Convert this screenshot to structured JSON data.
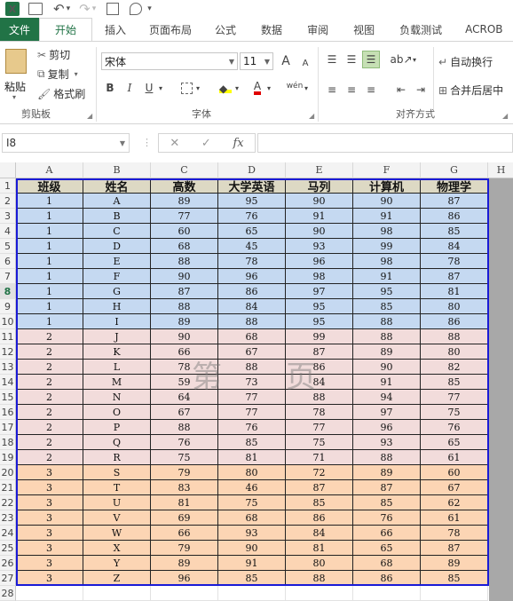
{
  "qat": {
    "save": "💾",
    "undo": "↶",
    "redo": "↷",
    "customize": "▾"
  },
  "tabs": [
    "文件",
    "开始",
    "插入",
    "页面布局",
    "公式",
    "数据",
    "审阅",
    "视图",
    "负载测试",
    "ACROB"
  ],
  "ribbon": {
    "clipboard": {
      "paste": "粘贴",
      "cut": "剪切",
      "copy": "复制",
      "format_painter": "格式刷",
      "label": "剪贴板"
    },
    "font": {
      "family": "宋体",
      "size": "11",
      "grow": "A",
      "shrink": "A",
      "bold": "B",
      "italic": "I",
      "underline": "U",
      "wen": "wén",
      "font_color": "A",
      "label": "字体"
    },
    "alignment": {
      "wrap": "自动换行",
      "merge": "合并后居中",
      "label": "对齐方式"
    }
  },
  "formula_bar": {
    "name_box": "I8",
    "fx": "fx",
    "value": ""
  },
  "colors": {
    "accent": "#217346",
    "group1": "#c5d9f1",
    "group2": "#f2dcdb",
    "group3": "#fcd5b4",
    "header_fill": "#ddd9c4",
    "border_blue": "#1a1ad6"
  },
  "sheet": {
    "columns": [
      "A",
      "B",
      "C",
      "D",
      "E",
      "F",
      "G",
      "H"
    ],
    "row_numbers": [
      "1",
      "2",
      "3",
      "4",
      "5",
      "6",
      "7",
      "8",
      "9",
      "10",
      "11",
      "12",
      "13",
      "14",
      "15",
      "16",
      "17",
      "18",
      "19",
      "20",
      "21",
      "22",
      "23",
      "24",
      "25",
      "26",
      "27",
      "28"
    ],
    "selected_row": "8",
    "headers": [
      "班级",
      "姓名",
      "高数",
      "大学英语",
      "马列",
      "计算机",
      "物理学"
    ],
    "rows": [
      [
        "1",
        "A",
        "89",
        "95",
        "90",
        "90",
        "87"
      ],
      [
        "1",
        "B",
        "77",
        "76",
        "91",
        "91",
        "86"
      ],
      [
        "1",
        "C",
        "60",
        "65",
        "90",
        "98",
        "85"
      ],
      [
        "1",
        "D",
        "68",
        "45",
        "93",
        "99",
        "84"
      ],
      [
        "1",
        "E",
        "88",
        "78",
        "96",
        "98",
        "78"
      ],
      [
        "1",
        "F",
        "90",
        "96",
        "98",
        "91",
        "87"
      ],
      [
        "1",
        "G",
        "87",
        "86",
        "97",
        "95",
        "81"
      ],
      [
        "1",
        "H",
        "88",
        "84",
        "95",
        "85",
        "80"
      ],
      [
        "1",
        "I",
        "89",
        "88",
        "95",
        "88",
        "86"
      ],
      [
        "2",
        "J",
        "90",
        "68",
        "99",
        "88",
        "88"
      ],
      [
        "2",
        "K",
        "66",
        "67",
        "87",
        "89",
        "80"
      ],
      [
        "2",
        "L",
        "78",
        "88",
        "86",
        "90",
        "82"
      ],
      [
        "2",
        "M",
        "59",
        "73",
        "84",
        "91",
        "85"
      ],
      [
        "2",
        "N",
        "64",
        "77",
        "88",
        "94",
        "77"
      ],
      [
        "2",
        "O",
        "67",
        "77",
        "78",
        "97",
        "75"
      ],
      [
        "2",
        "P",
        "88",
        "76",
        "77",
        "96",
        "76"
      ],
      [
        "2",
        "Q",
        "76",
        "85",
        "75",
        "93",
        "65"
      ],
      [
        "2",
        "R",
        "75",
        "81",
        "71",
        "88",
        "61"
      ],
      [
        "3",
        "S",
        "79",
        "80",
        "72",
        "89",
        "60"
      ],
      [
        "3",
        "T",
        "83",
        "46",
        "87",
        "87",
        "67"
      ],
      [
        "3",
        "U",
        "81",
        "75",
        "85",
        "85",
        "62"
      ],
      [
        "3",
        "V",
        "69",
        "68",
        "86",
        "76",
        "61"
      ],
      [
        "3",
        "W",
        "66",
        "93",
        "84",
        "66",
        "78"
      ],
      [
        "3",
        "X",
        "79",
        "90",
        "81",
        "65",
        "87"
      ],
      [
        "3",
        "Y",
        "89",
        "91",
        "80",
        "68",
        "89"
      ],
      [
        "3",
        "Z",
        "96",
        "85",
        "88",
        "86",
        "85"
      ]
    ],
    "watermark": [
      "第",
      "页"
    ]
  }
}
